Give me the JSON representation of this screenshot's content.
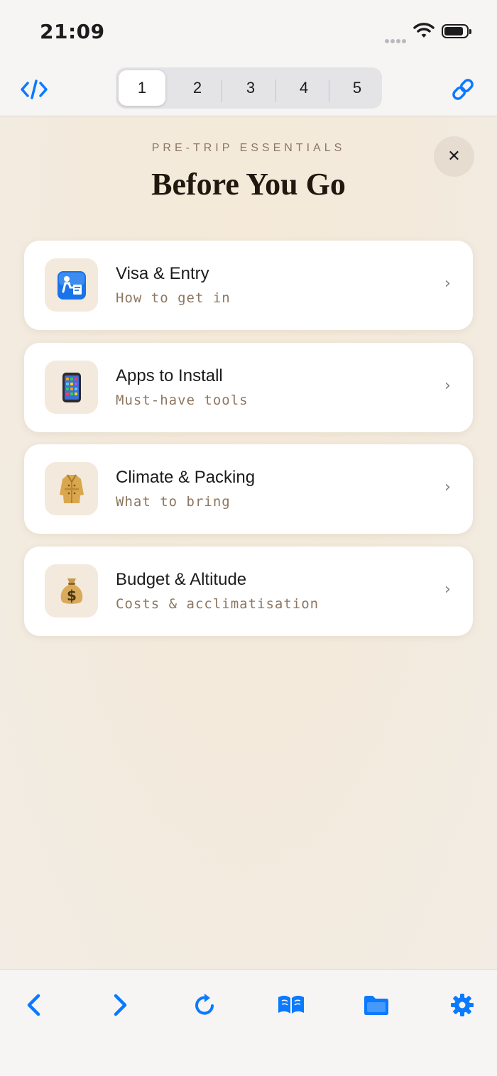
{
  "status_bar": {
    "time": "21:09"
  },
  "toolbar": {
    "tabs": [
      "1",
      "2",
      "3",
      "4",
      "5"
    ],
    "active_tab": "1"
  },
  "header": {
    "kicker": "PRE-TRIP ESSENTIALS",
    "title": "Before You Go",
    "close_icon": "close-icon"
  },
  "cards": [
    {
      "title": "Visa & Entry",
      "subtitle": "How to get in",
      "icon": "passport-control-icon"
    },
    {
      "title": "Apps to Install",
      "subtitle": "Must-have tools",
      "icon": "mobile-phone-icon"
    },
    {
      "title": "Climate & Packing",
      "subtitle": "What to bring",
      "icon": "coat-icon"
    },
    {
      "title": "Budget & Altitude",
      "subtitle": "Costs & acclimatisation",
      "icon": "money-bag-icon"
    }
  ],
  "bottom_bar": [
    "back-icon",
    "forward-icon",
    "reload-icon",
    "bookmarks-icon",
    "folder-icon",
    "settings-icon"
  ],
  "colors": {
    "accent": "#0a7aff",
    "card": "#ffffff",
    "icon_box": "#f3e9dc",
    "title": "#21180f"
  }
}
